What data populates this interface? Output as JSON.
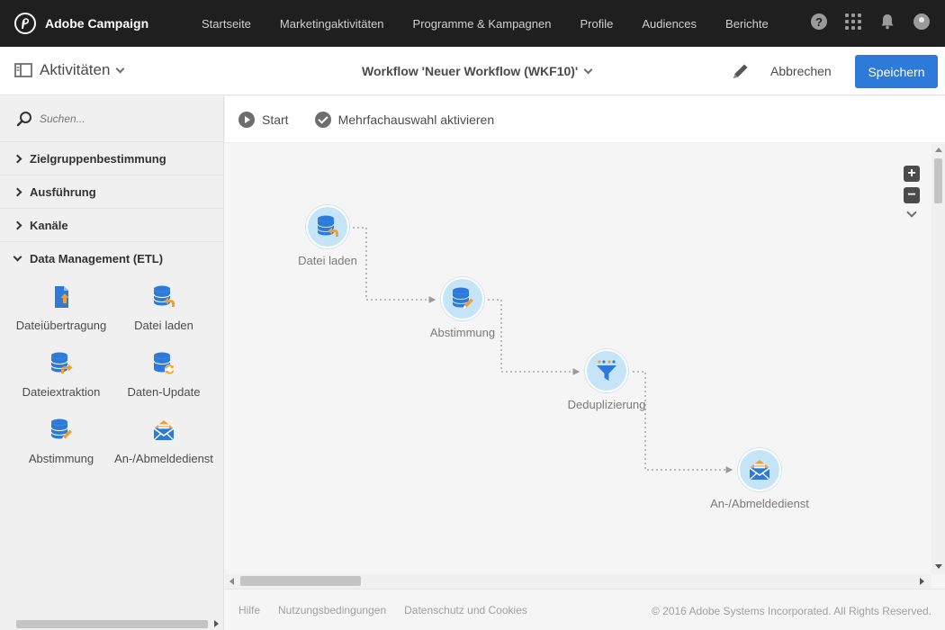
{
  "app": {
    "name": "Adobe Campaign"
  },
  "nav": {
    "items": [
      {
        "label": "Startseite"
      },
      {
        "label": "Marketingaktivitäten"
      },
      {
        "label": "Programme & Kampagnen"
      },
      {
        "label": "Profile"
      },
      {
        "label": "Audiences"
      },
      {
        "label": "Berichte"
      }
    ],
    "help_glyph": "?"
  },
  "actionbar": {
    "activities_label": "Aktivitäten",
    "workflow_title": "Workflow 'Neuer Workflow (WKF10)'",
    "cancel_label": "Abbrechen",
    "save_label": "Speichern"
  },
  "sidebar": {
    "search_placeholder": "Suchen...",
    "categories": [
      {
        "label": "Zielgruppenbestimmung",
        "expanded": false
      },
      {
        "label": "Ausführung",
        "expanded": false
      },
      {
        "label": "Kanäle",
        "expanded": false
      },
      {
        "label": "Data Management (ETL)",
        "expanded": true
      }
    ],
    "activities": [
      {
        "label": "Dateiübertragung",
        "icon": "file-transfer-icon"
      },
      {
        "label": "Datei laden",
        "icon": "load-file-icon"
      },
      {
        "label": "Dateiextraktion",
        "icon": "extract-file-icon"
      },
      {
        "label": "Daten-Update",
        "icon": "update-data-icon"
      },
      {
        "label": "Abstimmung",
        "icon": "reconciliation-icon"
      },
      {
        "label": "An-/Abmeldedienst",
        "icon": "subscription-service-icon"
      }
    ]
  },
  "toolbar": {
    "start_label": "Start",
    "multiselect_label": "Mehrfachauswahl aktivieren"
  },
  "workflow": {
    "nodes": [
      {
        "label": "Datei laden",
        "icon": "load-file-icon"
      },
      {
        "label": "Abstimmung",
        "icon": "reconciliation-icon"
      },
      {
        "label": "Deduplizierung",
        "icon": "deduplication-icon"
      },
      {
        "label": "An-/Abmeldedienst",
        "icon": "subscription-service-icon"
      }
    ]
  },
  "zoom": {
    "in": "+",
    "out": "−"
  },
  "footer": {
    "links": [
      {
        "label": "Hilfe"
      },
      {
        "label": "Nutzungsbedingungen"
      },
      {
        "label": "Datenschutz und Cookies"
      }
    ],
    "copyright": "© 2016 Adobe Systems Incorporated. All Rights Reserved."
  },
  "colors": {
    "accent": "#2d7ad9",
    "icon_blue": "#2d7ad9",
    "icon_orange": "#f0a030",
    "node_fill": "#c6e4f7",
    "topnav_bg": "#1f1f1f"
  }
}
